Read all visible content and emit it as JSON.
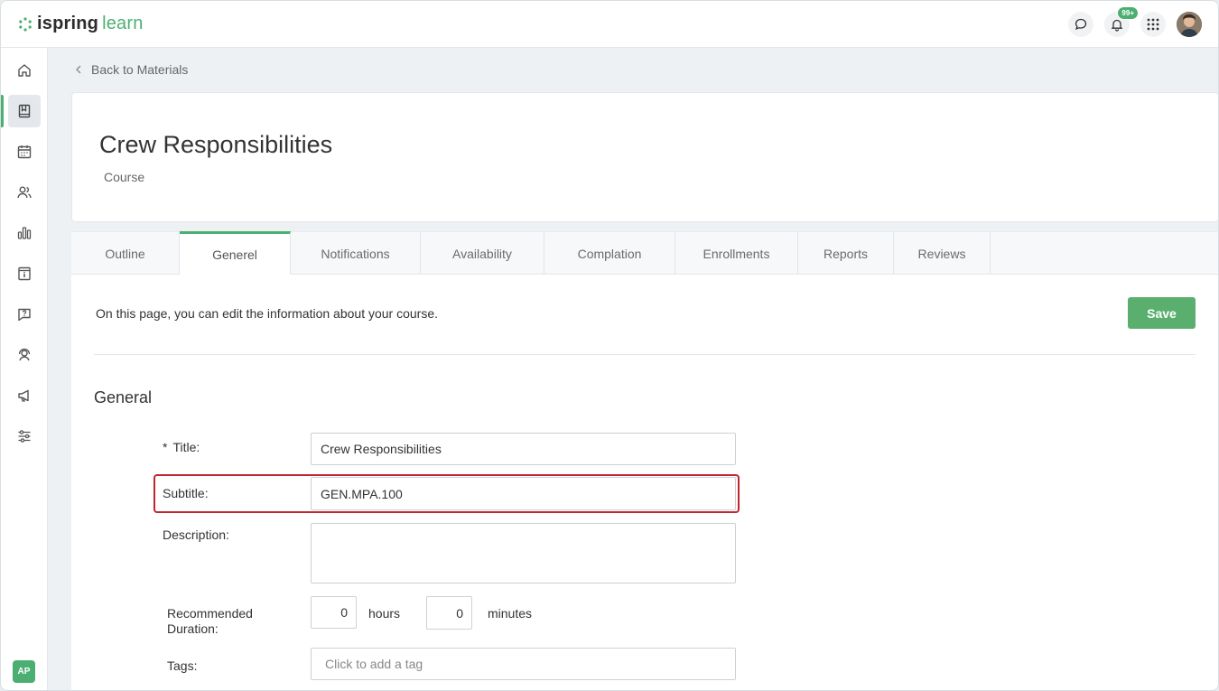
{
  "app": {
    "logo_bold": "ispring",
    "logo_light": "learn",
    "notifications_badge": "99+",
    "user_initials": "AP"
  },
  "colors": {
    "accent": "#4caf72",
    "highlight": "#c0262d"
  },
  "sidebar": {
    "items": [
      {
        "name": "home-icon"
      },
      {
        "name": "book-icon",
        "active": true
      },
      {
        "name": "calendar-icon"
      },
      {
        "name": "users-icon"
      },
      {
        "name": "bar-chart-icon"
      },
      {
        "name": "info-icon"
      },
      {
        "name": "question-chat-icon"
      },
      {
        "name": "support-agent-icon"
      },
      {
        "name": "megaphone-icon"
      },
      {
        "name": "settings-sliders-icon"
      }
    ]
  },
  "nav": {
    "back_label": "Back to Materials"
  },
  "header": {
    "title": "Crew Responsibilities",
    "type": "Course"
  },
  "tabs": [
    {
      "label": "Outline"
    },
    {
      "label": "Generel",
      "active": true
    },
    {
      "label": "Notifications"
    },
    {
      "label": "Availability"
    },
    {
      "label": "Complation"
    },
    {
      "label": "Enrollments"
    },
    {
      "label": "Reports"
    },
    {
      "label": "Reviews"
    }
  ],
  "content": {
    "intro": "On this page, you can edit the information about your course.",
    "save_label": "Save",
    "section_title": "General",
    "form": {
      "title_label": "Title:",
      "title_required_mark": "*",
      "title_value": "Crew Responsibilities",
      "subtitle_label": "Subtitle:",
      "subtitle_value": "GEN.MPA.100",
      "description_label": "Description:",
      "description_value": "",
      "duration_label_1": "Recommended",
      "duration_label_2": "Duration:",
      "hours_value": "0",
      "hours_label": "hours",
      "minutes_value": "0",
      "minutes_label": "minutes",
      "tags_label": "Tags:",
      "tags_placeholder": "Click to add a tag"
    }
  }
}
